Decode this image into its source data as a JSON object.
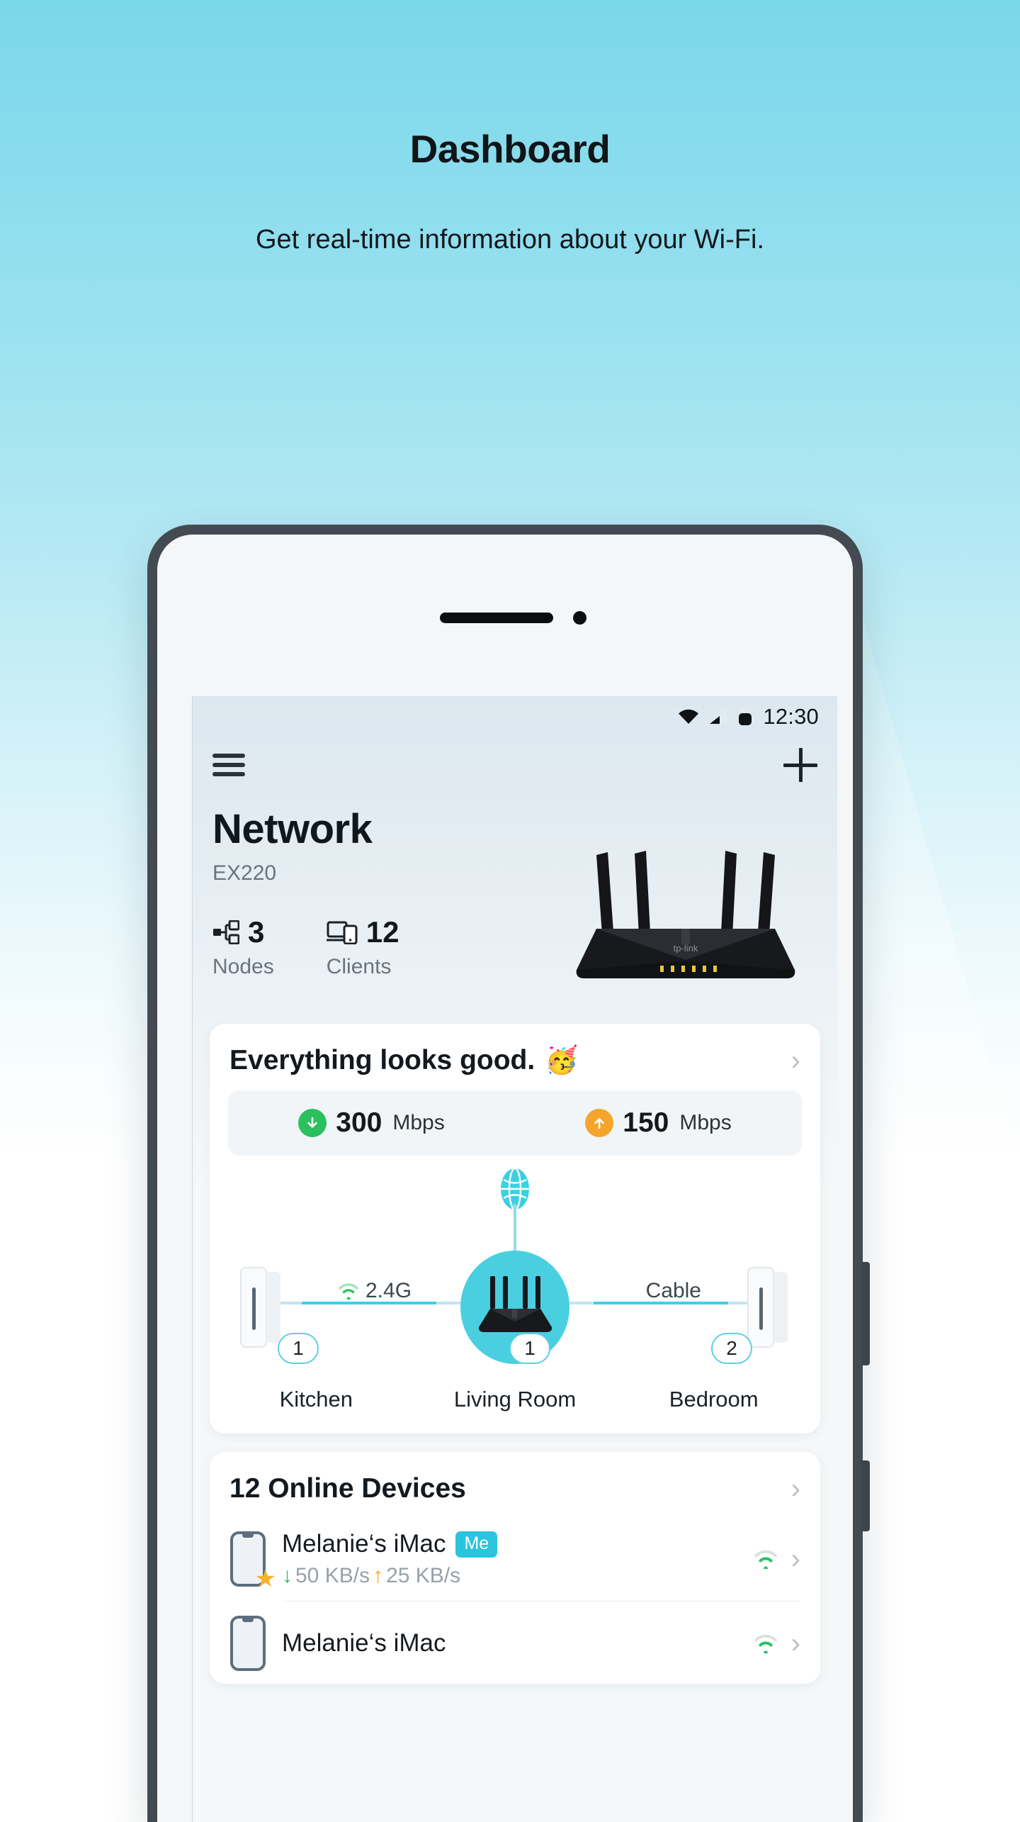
{
  "promo": {
    "title": "Dashboard",
    "subtitle": "Get real-time information about your Wi-Fi."
  },
  "phone": {
    "statusbar": {
      "time": "12:30",
      "wifi_icon": "wifi-icon",
      "signal_icon": "cellular-signal-icon",
      "battery_icon": "battery-icon"
    },
    "appbar": {
      "menu_icon": "hamburger-menu-icon",
      "add_icon": "plus-icon"
    },
    "hero": {
      "title": "Network",
      "model": "EX220",
      "stats": [
        {
          "icon": "nodes-icon",
          "value": "3",
          "label": "Nodes"
        },
        {
          "icon": "clients-icon",
          "value": "12",
          "label": "Clients"
        }
      ],
      "router_image": "router-illustration"
    },
    "status_card": {
      "title": "Everything looks good.",
      "emoji": "🥳",
      "chevron": "›",
      "speeds": [
        {
          "direction": "download",
          "arrow": "↓",
          "value": "300",
          "unit": "Mbps",
          "color": "#2bbf5e"
        },
        {
          "direction": "upload",
          "arrow": "↑",
          "value": "150",
          "unit": "Mbps",
          "color": "#f5a52b"
        }
      ],
      "topology": {
        "internet_icon": "globe-icon",
        "left_link": {
          "icon": "wifi-icon",
          "label": "2.4G"
        },
        "right_link": {
          "icon": "",
          "label": "Cable"
        },
        "nodes": [
          {
            "name": "Kitchen",
            "clients": "1",
            "type": "extender"
          },
          {
            "name": "Living Room",
            "clients": "1",
            "type": "router"
          },
          {
            "name": "Bedroom",
            "clients": "2",
            "type": "extender"
          }
        ]
      }
    },
    "devices_card": {
      "title": "12 Online Devices",
      "chevron": "›",
      "rows": [
        {
          "name": "Melanie‘s iMac",
          "badge": "Me",
          "down_arrow": "↓",
          "down": "50 KB/s",
          "up_arrow": "↑",
          "up": "25 KB/s",
          "wifi_icon": "wifi-icon",
          "chevron": "›",
          "favorite": "★"
        },
        {
          "name": "Melanie‘s iMac",
          "badge": "",
          "down_arrow": "",
          "down": "",
          "up_arrow": "",
          "up": "",
          "wifi_icon": "wifi-icon",
          "chevron": "›",
          "favorite": ""
        }
      ]
    }
  },
  "colors": {
    "page_top": "#7ad7ea",
    "accent_cyan": "#2bc4de",
    "hub_cyan": "#49cfe0",
    "download_green": "#2bbf5e",
    "upload_orange": "#f5a52b",
    "phone_frame": "#434a51"
  }
}
